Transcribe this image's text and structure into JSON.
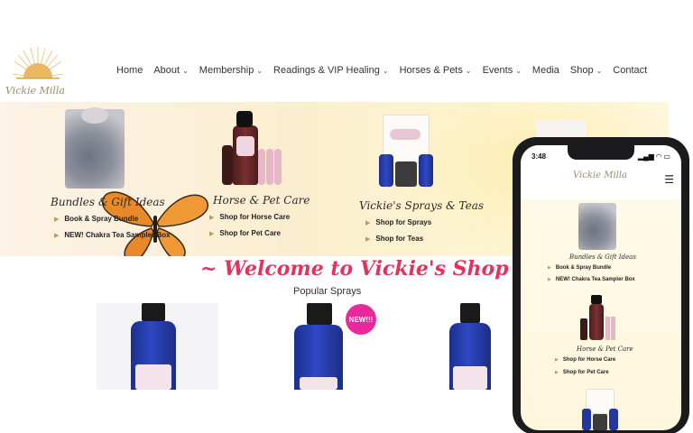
{
  "brand": {
    "name": "Vickie Milla"
  },
  "nav": [
    {
      "label": "Home",
      "has_dropdown": false
    },
    {
      "label": "About",
      "has_dropdown": true
    },
    {
      "label": "Membership",
      "has_dropdown": true
    },
    {
      "label": "Readings & VIP Healing",
      "has_dropdown": true
    },
    {
      "label": "Horses & Pets",
      "has_dropdown": true
    },
    {
      "label": "Events",
      "has_dropdown": true
    },
    {
      "label": "Media",
      "has_dropdown": false
    },
    {
      "label": "Shop",
      "has_dropdown": true
    },
    {
      "label": "Contact",
      "has_dropdown": false
    }
  ],
  "hero": {
    "columns": [
      {
        "title": "Bundles & Gift Ideas",
        "links": [
          "Book & Spray Bundle",
          "NEW! Chakra Tea Sampler Box"
        ]
      },
      {
        "title": "Horse & Pet Care",
        "links": [
          "Shop for Horse Care",
          "Shop for Pet Care"
        ]
      },
      {
        "title": "Vickie's Sprays & Teas",
        "links": [
          "Shop for Sprays",
          "Shop for Teas"
        ]
      }
    ]
  },
  "welcome": {
    "title": "~ Welcome to Vickie's Shop ~",
    "subtitle": "Popular Sprays",
    "badge": "NEW!!!"
  },
  "phone": {
    "time": "3:48",
    "brand": "Vickie Milla",
    "sections": [
      {
        "title": "Bundles & Gift Ideas",
        "links": [
          "Book & Spray Bundle",
          "NEW! Chakra Tea Sampler Box"
        ]
      },
      {
        "title": "Horse & Pet Care",
        "links": [
          "Shop for Horse Care",
          "Shop for Pet Care"
        ]
      }
    ]
  },
  "colors": {
    "accent": "#e0345e",
    "badge": "#e9289a",
    "gold": "#b59a63"
  }
}
